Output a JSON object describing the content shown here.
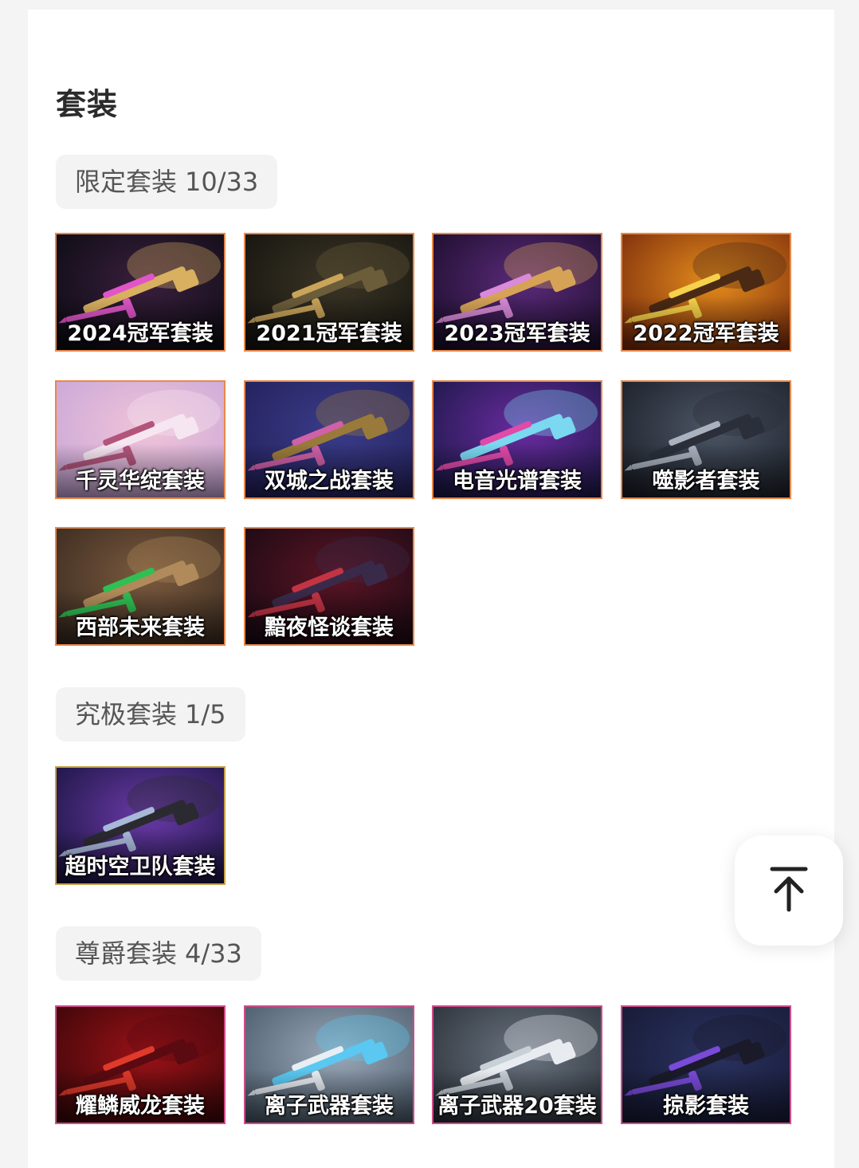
{
  "page": {
    "title": "套装"
  },
  "sections": [
    {
      "label": "限定套装",
      "count": "10/33",
      "items": [
        {
          "name": "2024冠军套装",
          "colors": [
            "#0b0b12",
            "#3a1f3e",
            "#e055c8",
            "#d8b060"
          ]
        },
        {
          "name": "2021冠军套装",
          "colors": [
            "#14130f",
            "#3b3525",
            "#c9a45a",
            "#6b5c3a"
          ]
        },
        {
          "name": "2023冠军套装",
          "colors": [
            "#1a0d2a",
            "#5b2a7a",
            "#d98ad8",
            "#d6a256"
          ]
        },
        {
          "name": "2022冠军套装",
          "colors": [
            "#7a2a0c",
            "#e48c1c",
            "#f6d24a",
            "#4a2a14"
          ]
        },
        {
          "name": "千灵华绽套装",
          "colors": [
            "#c8a7d8",
            "#f0c3d8",
            "#b2557a",
            "#f6e6f2"
          ]
        },
        {
          "name": "双城之战套装",
          "colors": [
            "#23205a",
            "#3a3c8a",
            "#d060a8",
            "#9a7a3a"
          ]
        },
        {
          "name": "电音光谱套装",
          "colors": [
            "#1c1848",
            "#6a2ba0",
            "#e04aa8",
            "#7ad8f0"
          ]
        },
        {
          "name": "噬影者套装",
          "colors": [
            "#1a1e26",
            "#4c5666",
            "#aab2bf",
            "#2a2f3a"
          ]
        },
        {
          "name": "西部未来套装",
          "colors": [
            "#3a2a20",
            "#7a5a3e",
            "#2fbf52",
            "#b08a5a"
          ]
        },
        {
          "name": "黯夜怪谈套装",
          "colors": [
            "#1a0a14",
            "#5a1424",
            "#c23444",
            "#3a2a4a"
          ]
        }
      ]
    },
    {
      "label": "究极套装",
      "count": "1/5",
      "items": [
        {
          "name": "超时空卫队套装",
          "colors": [
            "#1a1440",
            "#6a3aa8",
            "#a8b8d8",
            "#2a2a30"
          ]
        }
      ]
    },
    {
      "label": "尊爵套装",
      "count": "4/33",
      "items": [
        {
          "name": "耀鳞威龙套装",
          "colors": [
            "#3a0608",
            "#9a1218",
            "#e03a2a",
            "#5a0a10"
          ]
        },
        {
          "name": "离子武器套装",
          "colors": [
            "#4a5a6a",
            "#9aa8b8",
            "#e8eef4",
            "#5ac8f0"
          ]
        },
        {
          "name": "离子武器20套装",
          "colors": [
            "#2a3038",
            "#6a7480",
            "#c8d0d8",
            "#e8ecf0"
          ]
        },
        {
          "name": "掠影套装",
          "colors": [
            "#161a34",
            "#2a3260",
            "#7a4ad8",
            "#1a1a2a"
          ]
        }
      ]
    }
  ],
  "back_to_top": {
    "icon": "arrow-up-icon"
  }
}
